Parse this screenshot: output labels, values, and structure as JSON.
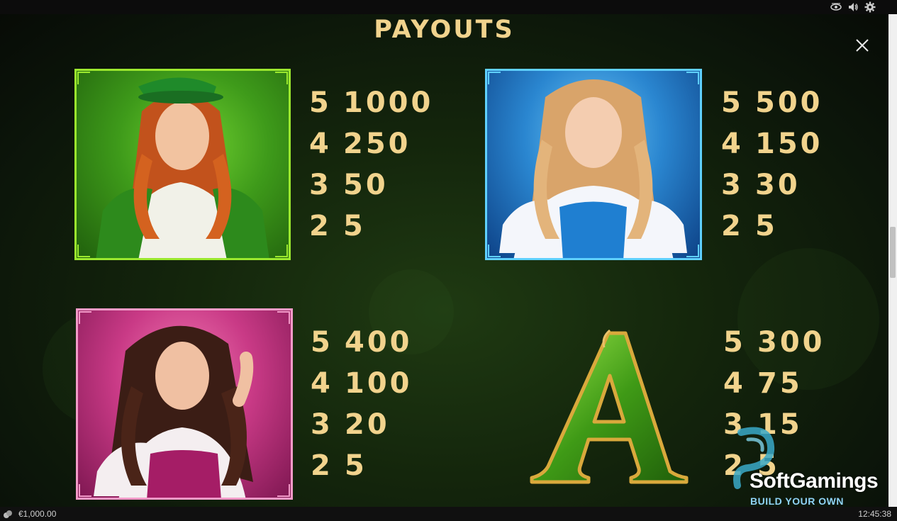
{
  "screen": {
    "title": "PAYOUTS"
  },
  "symbols": [
    {
      "name": "green-girl",
      "payouts": [
        {
          "count": "5",
          "value": "1000"
        },
        {
          "count": "4",
          "value": "250"
        },
        {
          "count": "3",
          "value": "50"
        },
        {
          "count": "2",
          "value": "5"
        }
      ]
    },
    {
      "name": "blue-girl",
      "payouts": [
        {
          "count": "5",
          "value": "500"
        },
        {
          "count": "4",
          "value": "150"
        },
        {
          "count": "3",
          "value": "30"
        },
        {
          "count": "2",
          "value": "5"
        }
      ]
    },
    {
      "name": "pink-girl",
      "payouts": [
        {
          "count": "5",
          "value": "400"
        },
        {
          "count": "4",
          "value": "100"
        },
        {
          "count": "3",
          "value": "20"
        },
        {
          "count": "2",
          "value": "5"
        }
      ]
    },
    {
      "name": "ace",
      "letter": "A",
      "payouts": [
        {
          "count": "5",
          "value": "300"
        },
        {
          "count": "4",
          "value": "75"
        },
        {
          "count": "3",
          "value": "15"
        },
        {
          "count": "2",
          "value": "5"
        }
      ]
    }
  ],
  "status": {
    "balance": "€1,000.00",
    "time": "12:45:38"
  },
  "watermark": {
    "brand": "SoftGamings",
    "tagline": "BUILD YOUR OWN CASINO"
  },
  "colors": {
    "gold_text": "#f1d38d",
    "green_frame": "#9be82e",
    "blue_frame": "#5fd0ff",
    "pink_frame": "#f29ac8"
  },
  "icons": {
    "top": [
      "eye-icon",
      "speaker-icon",
      "gear-icon"
    ],
    "close": "close-icon"
  }
}
